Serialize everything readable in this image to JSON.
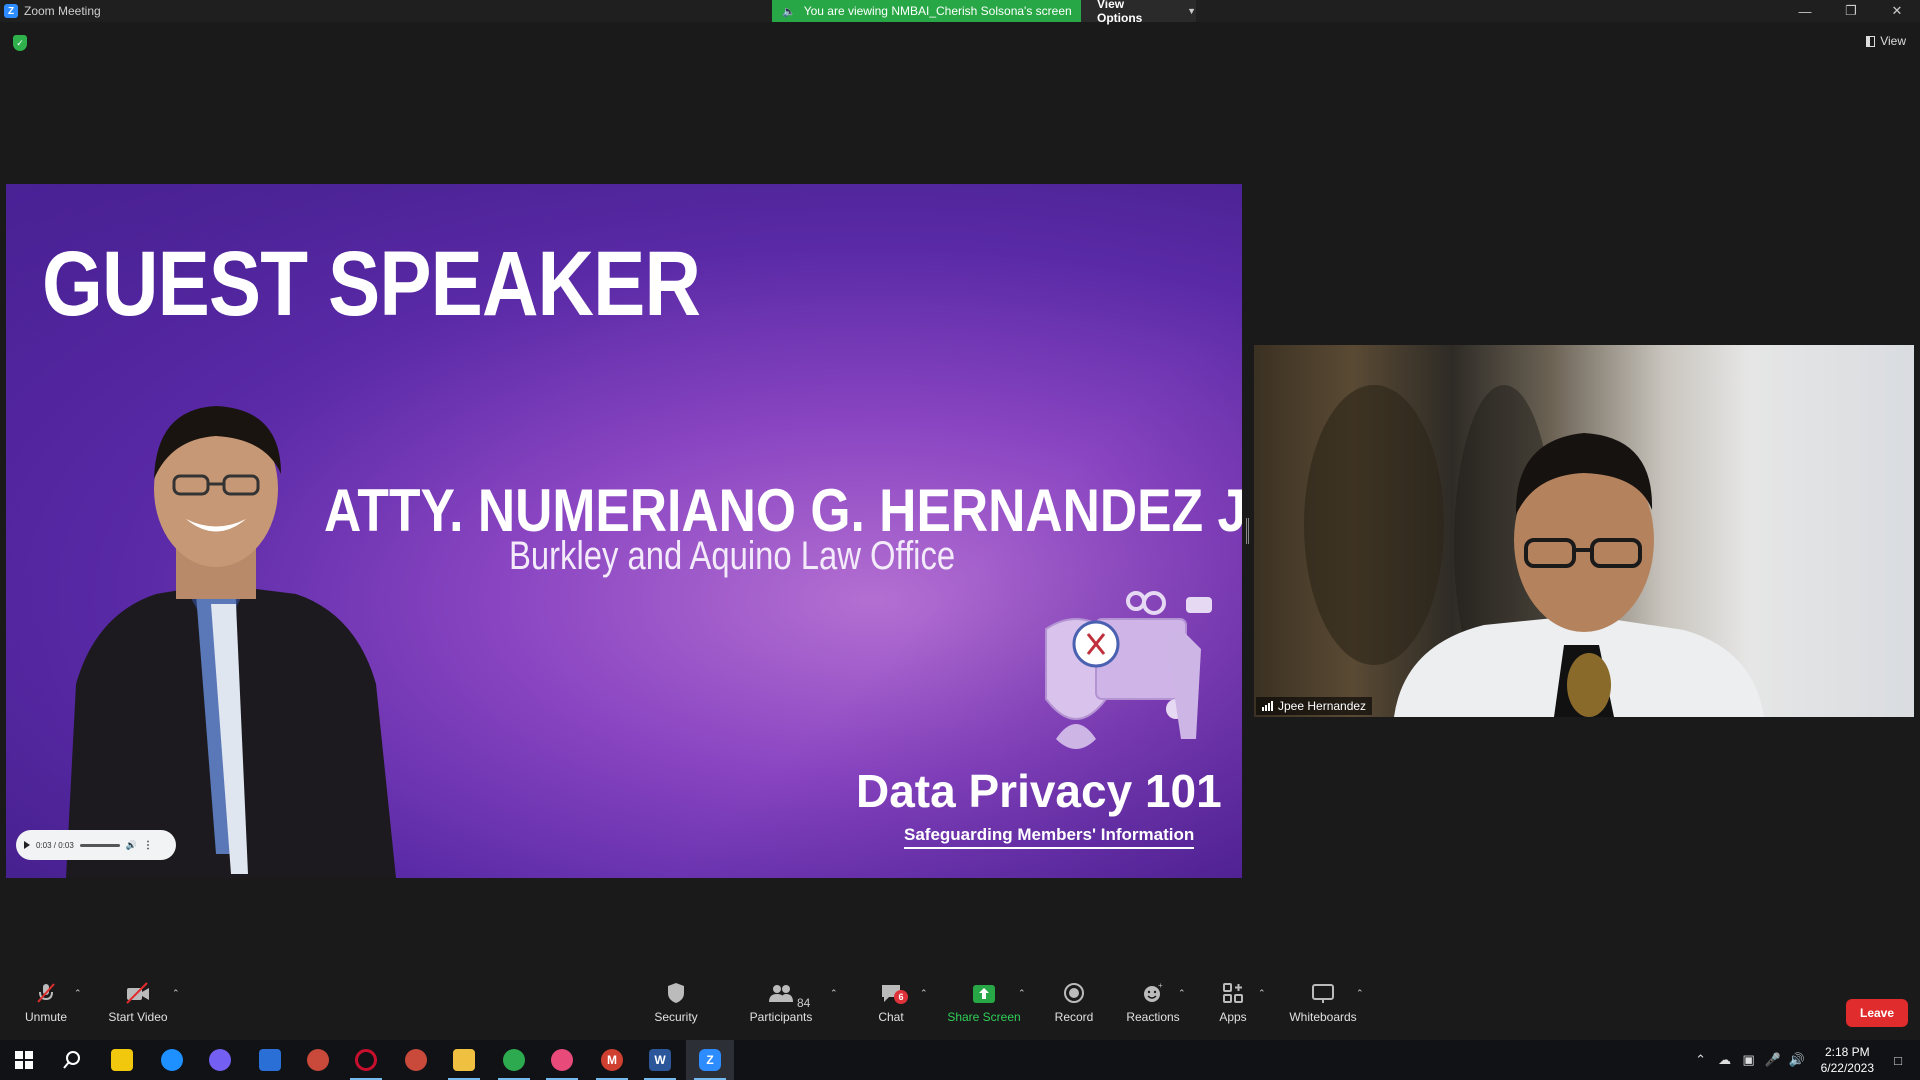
{
  "window": {
    "title": "Zoom Meeting"
  },
  "share_banner": {
    "text": "You are viewing NMBAI_Cherish Solsona's screen"
  },
  "view_options": {
    "label": "View Options"
  },
  "view_button": {
    "label": "View"
  },
  "slide": {
    "title": "GUEST SPEAKER",
    "speaker_name": "ATTY. NUMERIANO G. HERNANDEZ JR.",
    "speaker_org": "Burkley and Aquino Law Office",
    "course_title": "Data Privacy 101",
    "course_tagline": "Safeguarding Members' Information",
    "audio_time": "0:03 / 0:03"
  },
  "participant_video": {
    "name": "Jpee Hernandez"
  },
  "toolbar": {
    "unmute": "Unmute",
    "start_video": "Start Video",
    "security": "Security",
    "participants": "Participants",
    "participants_count": "84",
    "chat": "Chat",
    "chat_badge": "6",
    "share_screen": "Share Screen",
    "record": "Record",
    "reactions": "Reactions",
    "apps": "Apps",
    "whiteboards": "Whiteboards",
    "leave": "Leave"
  },
  "taskbar": {
    "time": "2:18 PM",
    "date": "6/22/2023"
  },
  "colors": {
    "share_green": "#27a745",
    "leave_red": "#e02c2c",
    "zoom_blue": "#2d8cff",
    "slide_purple": "#8a45c2"
  }
}
